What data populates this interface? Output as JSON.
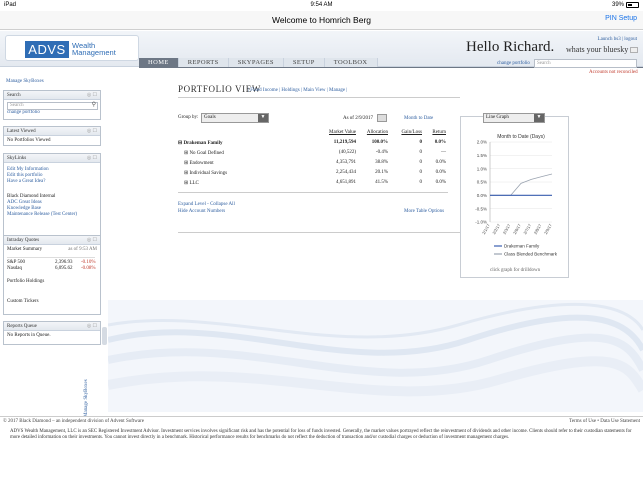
{
  "status_bar": {
    "carrier": "iPad",
    "time": "9:54 AM",
    "battery": "39%"
  },
  "nav": {
    "title": "Welcome to Homrich Berg",
    "pin_setup": "PIN Setup"
  },
  "header": {
    "logo_box": "ADVS",
    "logo_text_1": "Wealth",
    "logo_text_2": "Management",
    "greeting": "Hello Richard.",
    "tagline": "whats your bluesky",
    "links": "Launch bs3 | logout",
    "tabs": [
      "HOME",
      "REPORTS",
      "SKYPAGES",
      "SETUP",
      "TOOLBOX"
    ],
    "change_portfolio": "change portfolio",
    "search_placeholder": "Search",
    "alert": "Accounts not reconciled"
  },
  "sidebar": {
    "manage_skyboxes": "Manage SkyBoxes",
    "search": {
      "title": "Search",
      "placeholder": "Search",
      "change_portfolio": "change portfolio"
    },
    "latest_viewed": {
      "title": "Latest Viewed",
      "text": "No Portfolios Viewed"
    },
    "skylinks": {
      "title": "SkyLinks",
      "group1": [
        "Edit My Information",
        "Edit this portfolio",
        "Have a Great Idea?"
      ],
      "heading2": "Black Diamond Internal",
      "group2": [
        "ADC Great Ideas",
        "Knowledge Base",
        "Maintenance Release (Test Center)"
      ]
    },
    "quotes": {
      "title": "Intraday Quotes",
      "market_summary": "Market Summary",
      "as_of": "as of 9:53 AM",
      "rows": [
        {
          "name": "S&P 500",
          "value": "2,396.93",
          "change": "-0.10%"
        },
        {
          "name": "Nasdaq",
          "value": "6,095.62",
          "change": "-0.08%"
        }
      ],
      "portfolio_holdings": "Portfolio Holdings",
      "custom_tickers": "Custom Tickers"
    },
    "reports_queue": {
      "title": "Reports Queue",
      "text": "No Reports in Queue."
    },
    "vertical_label": "Manage SkyBoxes"
  },
  "portfolio": {
    "title": "PORTFOLIO VIEW",
    "links": [
      "Fixed Income",
      "Holdings",
      "Main View",
      "Manage"
    ],
    "group_by_label": "Group by:",
    "group_by_value": "Goals",
    "as_of": "As of 2/9/2017",
    "month_to_date": "Month to Date",
    "columns": [
      "Market Value",
      "Allocation",
      "Gain/Loss",
      "Return"
    ],
    "rows": [
      {
        "name": "⊟ Drakeman Family",
        "mv": "11,219,594",
        "alloc": "100.0%",
        "gl": "0",
        "ret": "0.0%",
        "bold": true,
        "indent": 0
      },
      {
        "name": "⊞ No Goal Defined",
        "mv": "(40,522)",
        "alloc": "-0.4%",
        "gl": "0",
        "ret": "—",
        "bold": false,
        "indent": 1
      },
      {
        "name": "⊞ Endowment",
        "mv": "4,353,791",
        "alloc": "38.8%",
        "gl": "0",
        "ret": "0.0%",
        "bold": false,
        "indent": 1
      },
      {
        "name": "⊞ Individual Savings",
        "mv": "2,254,434",
        "alloc": "20.1%",
        "gl": "0",
        "ret": "0.0%",
        "bold": false,
        "indent": 1
      },
      {
        "name": "⊞ LLC",
        "mv": "4,651,891",
        "alloc": "41.5%",
        "gl": "0",
        "ret": "0.0%",
        "bold": false,
        "indent": 1
      }
    ],
    "expand_collapse": "Expand Level - Collapse All",
    "hide_account_numbers": "Hide Account Numbers",
    "more_table_options": "More Table Options"
  },
  "chart_panel": {
    "selector_value": "Line Graph",
    "click_hint": "click graph for drilldown"
  },
  "chart_data": {
    "type": "line",
    "title": "Month to Date (Days)",
    "x": [
      "2/1/17",
      "2/2/17",
      "2/3/17",
      "2/6/17",
      "2/7/17",
      "2/8/17",
      "2/9/17"
    ],
    "yticks": [
      "2.0%",
      "1.5%",
      "1.0%",
      "0.5%",
      "0.0%",
      "-0.5%",
      "-1.0%"
    ],
    "ylim": [
      -1.0,
      2.0
    ],
    "series": [
      {
        "name": "Drakeman Family",
        "color": "#3a5fb0",
        "values": [
          0.0,
          0.0,
          0.0,
          0.0,
          0.0,
          0.0,
          0.0
        ]
      },
      {
        "name": "Class Blended Benchmark",
        "color": "#9aa3b0",
        "values": [
          0.0,
          0.0,
          0.0,
          0.45,
          0.6,
          0.7,
          0.8
        ]
      }
    ]
  },
  "footer": {
    "copyright": "© 2017 Black Diamond – an independent division of Advent Software",
    "terms": "Terms of Use • Data Use Statement",
    "disclaimer": "ADVS Wealth Management, LLC is an SEC Registered Investment Advisor. Investment services involves significant risk and has the potential for loss of funds invested. Generally, the market values portrayed reflect the reinvestment of dividends and other income. Clients should refer to their custodian statements for more detailed information on their investments. You cannot invest directly in a benchmark. Historical performance results for benchmarks do not reflect the deduction of transaction and/or custodial charges or deduction of investment management charges."
  }
}
